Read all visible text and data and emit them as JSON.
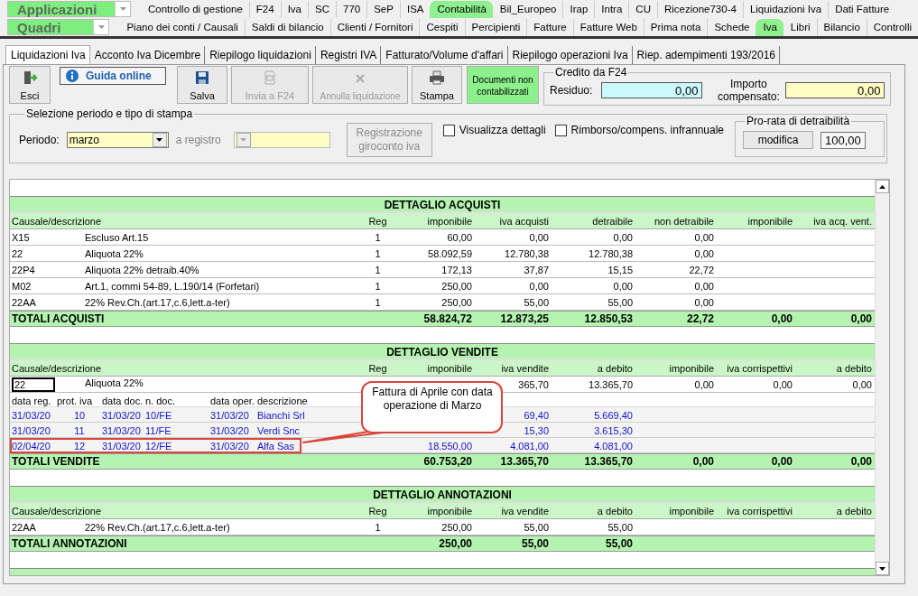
{
  "app_menu": {
    "applicazioni": "Applicazioni",
    "quadri": "Quadri"
  },
  "top_tabs": [
    {
      "label": "Controllo di gestione",
      "selected": false
    },
    {
      "label": "F24",
      "selected": false
    },
    {
      "label": "Iva",
      "selected": false
    },
    {
      "label": "SC",
      "selected": false
    },
    {
      "label": "770",
      "selected": false
    },
    {
      "label": "SeP",
      "selected": false
    },
    {
      "label": "ISA",
      "selected": false
    },
    {
      "label": "Contabilità",
      "selected": true
    },
    {
      "label": "Bil_Europeo",
      "selected": false
    },
    {
      "label": "Irap",
      "selected": false
    },
    {
      "label": "Intra",
      "selected": false
    },
    {
      "label": "CU",
      "selected": false
    },
    {
      "label": "Ricezione730-4",
      "selected": false
    },
    {
      "label": "Liquidazioni Iva",
      "selected": false
    },
    {
      "label": "Dati Fatture",
      "selected": false
    }
  ],
  "sub_tabs": [
    {
      "label": "Piano dei conti / Causali",
      "selected": false
    },
    {
      "label": "Saldi di bilancio",
      "selected": false
    },
    {
      "label": "Clienti / Fornitori",
      "selected": false
    },
    {
      "label": "Cespiti",
      "selected": false
    },
    {
      "label": "Percipienti",
      "selected": false
    },
    {
      "label": "Fatture",
      "selected": false
    },
    {
      "label": "Fatture Web",
      "selected": false
    },
    {
      "label": "Prima nota",
      "selected": false
    },
    {
      "label": "Schede",
      "selected": false
    },
    {
      "label": "Iva",
      "selected": true
    },
    {
      "label": "Libri",
      "selected": false
    },
    {
      "label": "Bilancio",
      "selected": false
    },
    {
      "label": "Controlli",
      "selected": false
    }
  ],
  "page_tabs": [
    {
      "label": "Liquidazioni Iva",
      "selected": true
    },
    {
      "label": "Acconto Iva Dicembre",
      "selected": false
    },
    {
      "label": "Riepilogo liquidazioni",
      "selected": false
    },
    {
      "label": "Registri IVA",
      "selected": false
    },
    {
      "label": "Fatturato/Volume d'affari",
      "selected": false
    },
    {
      "label": "Riepilogo operazioni Iva",
      "selected": false
    },
    {
      "label": "Riep. adempimenti 193/2016",
      "selected": false
    }
  ],
  "toolbar": {
    "exit": "Esci",
    "help": "Guida online",
    "actions": [
      {
        "label": "Salva",
        "kind": "save",
        "disabled": false
      },
      {
        "label": "Invia a F24",
        "kind": "f24",
        "disabled": true
      },
      {
        "label": "Annulla liquidazione",
        "kind": "cancel",
        "disabled": true
      },
      {
        "label": "Stampa",
        "kind": "print",
        "disabled": false
      },
      {
        "label": "Documenti non contabilizzati",
        "kind": "highlight",
        "disabled": false
      }
    ]
  },
  "credito": {
    "title": "Credito da F24",
    "residuo_label": "Residuo:",
    "residuo": "0,00",
    "compensato_label": "Importo compensato:",
    "compensato": "0,00"
  },
  "selezione": {
    "title": "Selezione periodo e tipo di stampa",
    "periodo_label": "Periodo:",
    "periodo": "marzo",
    "registro_label": "a registro",
    "registro_disabled": true,
    "giroconto": "Registrazione giroconto iva",
    "giroconto_disabled": true
  },
  "options": [
    {
      "label": "Visualizza dettagli",
      "checked": false
    },
    {
      "label": "Rimborso/compens. infrannuale",
      "checked": false
    }
  ],
  "pro_rata": {
    "title": "Pro-rata di detraibilità",
    "button": "modifica",
    "value": "100,00"
  },
  "sections": [
    {
      "title": "DETTAGLIO ACQUISTI",
      "columns": [
        "Causale/descrizione",
        "Reg",
        "imponibile",
        "iva acquisti",
        "detraibile",
        "non detraibile",
        "imponibile",
        "iva acq. vent."
      ],
      "rows": [
        {
          "code": "X15",
          "description": "Escluso Art.15",
          "reg": "1",
          "values": {
            "c3": "60,00",
            "c4": "0,00",
            "c5": "0,00",
            "c6": "0,00"
          }
        },
        {
          "code": "22",
          "description": "Aliquota 22%",
          "reg": "1",
          "values": {
            "c3": "58.092,59",
            "c4": "12.780,38",
            "c5": "12.780,38",
            "c6": "0,00"
          }
        },
        {
          "code": "22P4",
          "description": "Aliquota 22% detraib.40%",
          "reg": "1",
          "values": {
            "c3": "172,13",
            "c4": "37,87",
            "c5": "15,15",
            "c6": "22,72"
          }
        },
        {
          "code": "M02",
          "description": "Art.1, commi 54-89, L.190/14 (Forfetari)",
          "reg": "1",
          "values": {
            "c3": "250,00",
            "c4": "0,00",
            "c5": "0,00",
            "c6": "0,00"
          }
        },
        {
          "code": "22AA",
          "description": "22% Rev.Ch.(art.17,c.6,lett.a-ter)",
          "reg": "1",
          "values": {
            "c3": "250,00",
            "c4": "55,00",
            "c5": "55,00",
            "c6": "0,00"
          }
        }
      ],
      "totals": {
        "label": "TOTALI ACQUISTI",
        "values": [
          "58.824,72",
          "12.873,25",
          "12.850,53",
          "22,72",
          "0,00",
          "0,00"
        ]
      }
    },
    {
      "title": "DETTAGLIO VENDITE",
      "columns": [
        "Causale/descrizione",
        "Reg",
        "imponibile",
        "iva vendite",
        "a debito",
        "imponibile",
        "iva corrispettivi",
        "a debito"
      ],
      "rows": [
        {
          "code": "22",
          "description": "Aliquota 22%",
          "focused": true,
          "values": {
            "c4": "365,70",
            "c5": "13.365,70",
            "c6": "0,00",
            "c7": "0,00",
            "c8": "0,00"
          }
        }
      ],
      "details": {
        "columns": [
          "data reg.",
          "prot. iva",
          "data doc.",
          "n. doc.",
          "data oper.",
          "descrizione"
        ],
        "rows": [
          {
            "cells": [
              "31/03/20",
              "10",
              "31/03/20",
              "10/FE",
              "31/03/20",
              "Bianchi Srl"
            ],
            "values": {
              "c4": "69,40",
              "c5": "5.669,40"
            },
            "highlighted": false
          },
          {
            "cells": [
              "31/03/20",
              "11",
              "31/03/20",
              "11/FE",
              "31/03/20",
              "Verdi Snc"
            ],
            "values": {
              "c4": "15,30",
              "c5": "3.615,30"
            },
            "highlighted": false
          },
          {
            "cells": [
              "02/04/20",
              "12",
              "31/03/20",
              "12/FE",
              "31/03/20",
              "Alfa Sas"
            ],
            "values": {
              "c3": "18.550,00",
              "c4": "4.081,00",
              "c5": "4.081,00"
            },
            "highlighted": true
          }
        ]
      },
      "totals": {
        "label": "TOTALI VENDITE",
        "values": [
          "60.753,20",
          "13.365,70",
          "13.365,70",
          "0,00",
          "0,00",
          "0,00"
        ]
      }
    },
    {
      "title": "DETTAGLIO ANNOTAZIONI",
      "columns": [
        "Causale/descrizione",
        "Reg",
        "imponibile",
        "iva vendite",
        "a debito",
        "imponibile",
        "iva corrispettivi",
        "a debito"
      ],
      "rows": [
        {
          "code": "22AA",
          "description": "22% Rev.Ch.(art.17,c.6,lett.a-ter)",
          "reg": "1",
          "values": {
            "c3": "250,00",
            "c4": "55,00",
            "c5": "55,00"
          }
        }
      ],
      "totals": {
        "label": "TOTALI ANNOTAZIONI",
        "values": [
          "250,00",
          "55,00",
          "55,00"
        ]
      }
    }
  ],
  "callout": {
    "text": "Fattura di Aprile con data operazione di Marzo"
  }
}
